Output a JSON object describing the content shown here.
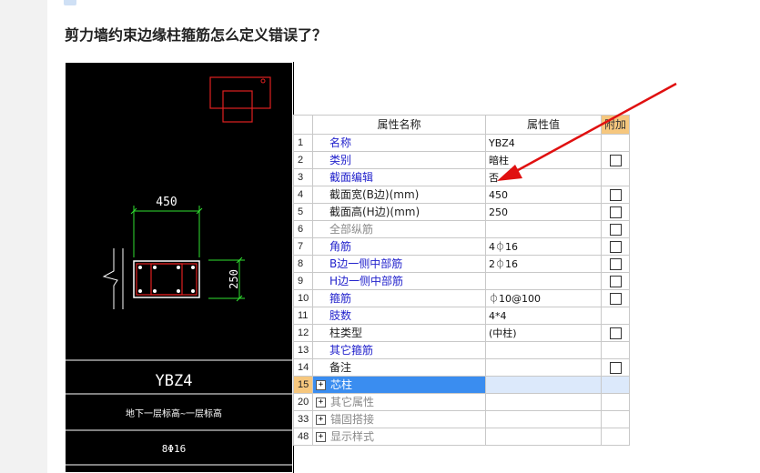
{
  "question": {
    "title": "剪力墙约束边缘柱箍筋怎么定义错误了？"
  },
  "cad": {
    "dim_width": "450",
    "dim_height": "250",
    "table_name": "YBZ4",
    "table_level": "地下一层标高~一层标高",
    "table_rebar": "8Φ16"
  },
  "grid": {
    "headers": {
      "name": "属性名称",
      "value": "属性值",
      "extra": "附加"
    },
    "rows": [
      {
        "num": "1",
        "name": "名称",
        "value": "YBZ4",
        "check": false
      },
      {
        "num": "2",
        "name": "类别",
        "value": "暗柱",
        "check": true
      },
      {
        "num": "3",
        "name": "截面编辑",
        "value": "否",
        "check": false
      },
      {
        "num": "4",
        "name": "截面宽(B边)(mm)",
        "value": "450",
        "check": true
      },
      {
        "num": "5",
        "name": "截面高(H边)(mm)",
        "value": "250",
        "check": true
      },
      {
        "num": "6",
        "name": "全部纵筋",
        "value": "",
        "check": true
      },
      {
        "num": "7",
        "name": "角筋",
        "value": "4⏀16",
        "check": true
      },
      {
        "num": "8",
        "name": "B边一侧中部筋",
        "value": "2⏀16",
        "check": true
      },
      {
        "num": "9",
        "name": "H边一侧中部筋",
        "value": "",
        "check": true
      },
      {
        "num": "10",
        "name": "箍筋",
        "value": "⏀10@100",
        "check": true
      },
      {
        "num": "11",
        "name": "肢数",
        "value": "4*4",
        "check": false
      },
      {
        "num": "12",
        "name": "柱类型",
        "value": "(中柱)",
        "check": true
      },
      {
        "num": "13",
        "name": "其它箍筋",
        "value": "",
        "check": false
      },
      {
        "num": "14",
        "name": "备注",
        "value": "",
        "check": true
      }
    ],
    "groups": [
      {
        "num": "15",
        "name": "芯柱"
      },
      {
        "num": "20",
        "name": "其它属性"
      },
      {
        "num": "33",
        "name": "锚固搭接"
      },
      {
        "num": "48",
        "name": "显示样式"
      }
    ]
  }
}
